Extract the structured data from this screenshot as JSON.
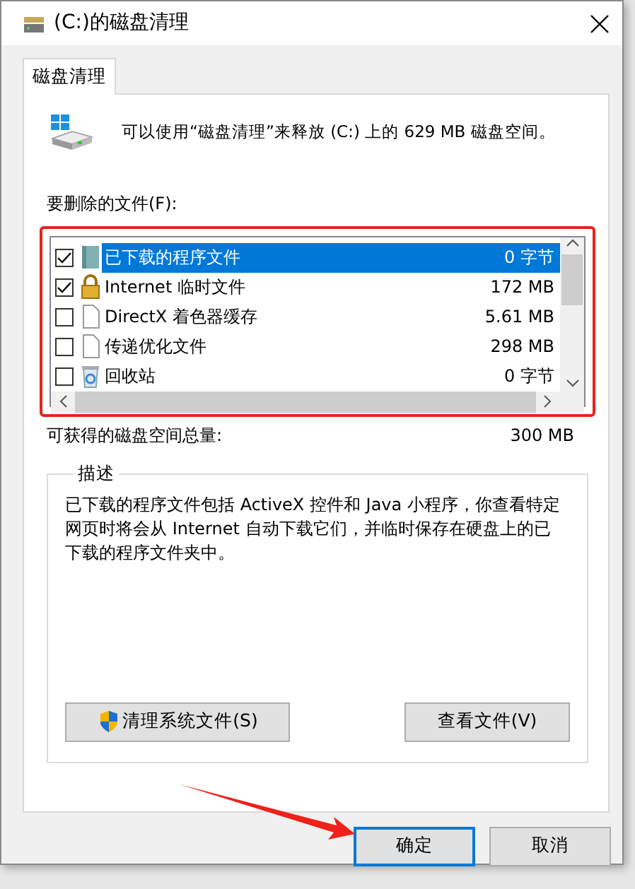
{
  "window": {
    "title": "(C:)的磁盘清理"
  },
  "tabs": [
    {
      "label": "磁盘清理",
      "selected": true
    }
  ],
  "intro": "可以使用“磁盘清理”来释放 (C:) 上的 629 MB 磁盘空间。",
  "files_label": "要删除的文件(F):",
  "files": [
    {
      "name": "已下载的程序文件",
      "size": "0 字节",
      "checked": true,
      "selected": true
    },
    {
      "name": "Internet 临时文件",
      "size": "172 MB",
      "checked": true,
      "selected": false
    },
    {
      "name": "DirectX 着色器缓存",
      "size": "5.61 MB",
      "checked": false,
      "selected": false
    },
    {
      "name": "传递优化文件",
      "size": "298 MB",
      "checked": false,
      "selected": false
    },
    {
      "name": "回收站",
      "size": "0 字节",
      "checked": false,
      "selected": false
    }
  ],
  "total": {
    "label": "可获得的磁盘空间总量:",
    "value": "300 MB"
  },
  "description": {
    "title": "描述",
    "text": "已下载的程序文件包括 ActiveX 控件和 Java 小程序，你查看特定网页时将会从 Internet 自动下载它们，并临时保存在硬盘上的已下载的程序文件夹中。"
  },
  "panel_buttons": [
    "清理系统文件(S)",
    "查看文件(V)"
  ],
  "buttons": [
    {
      "label": "确定",
      "default": true
    },
    {
      "label": "取消",
      "default": false
    }
  ],
  "annotations": {
    "highlight_box": true,
    "arrow": true
  }
}
